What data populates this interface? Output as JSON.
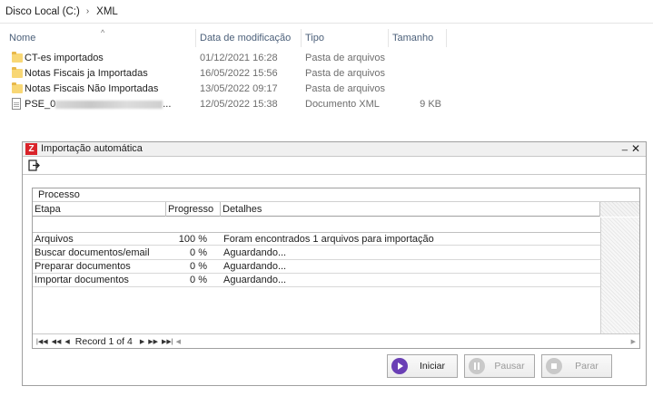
{
  "breadcrumb": [
    "Disco Local (C:)",
    "XML"
  ],
  "file_list": {
    "columns": [
      "Nome",
      "Data de modificação",
      "Tipo",
      "Tamanho"
    ],
    "rows": [
      {
        "name": "CT-es importados",
        "date": "01/12/2021 16:28",
        "type": "Pasta de arquivos",
        "size": "",
        "icon": "folder-icon"
      },
      {
        "name": "Notas Fiscais ja Importadas",
        "date": "16/05/2022 15:56",
        "type": "Pasta de arquivos",
        "size": "",
        "icon": "folder-icon"
      },
      {
        "name": "Notas Fiscais Não Importadas",
        "date": "13/05/2022 09:17",
        "type": "Pasta de arquivos",
        "size": "",
        "icon": "folder-icon"
      },
      {
        "name": "PSE_0",
        "name_suffix": "...",
        "date": "12/05/2022 15:38",
        "type": "Documento XML",
        "size": "9 KB",
        "icon": "xml-file-icon"
      }
    ]
  },
  "dialog": {
    "title": "Importação automática",
    "minimize": "_",
    "close": "✕",
    "group_label": "Processo",
    "columns": [
      "Etapa",
      "Progresso",
      "Detalhes"
    ],
    "rows": [
      {
        "etapa": "Arquivos",
        "progresso": "100 %",
        "detalhes": "Foram encontrados 1 arquivos para importação"
      },
      {
        "etapa": "Buscar documentos/email",
        "progresso": "0 %",
        "detalhes": "Aguardando..."
      },
      {
        "etapa": "Preparar documentos",
        "progresso": "0 %",
        "detalhes": "Aguardando..."
      },
      {
        "etapa": "Importar documentos",
        "progresso": "0 %",
        "detalhes": "Aguardando..."
      }
    ],
    "navigator": {
      "record_text": "Record 1 of 4"
    },
    "buttons": {
      "start": "Iniciar",
      "pause": "Pausar",
      "stop": "Parar"
    }
  }
}
